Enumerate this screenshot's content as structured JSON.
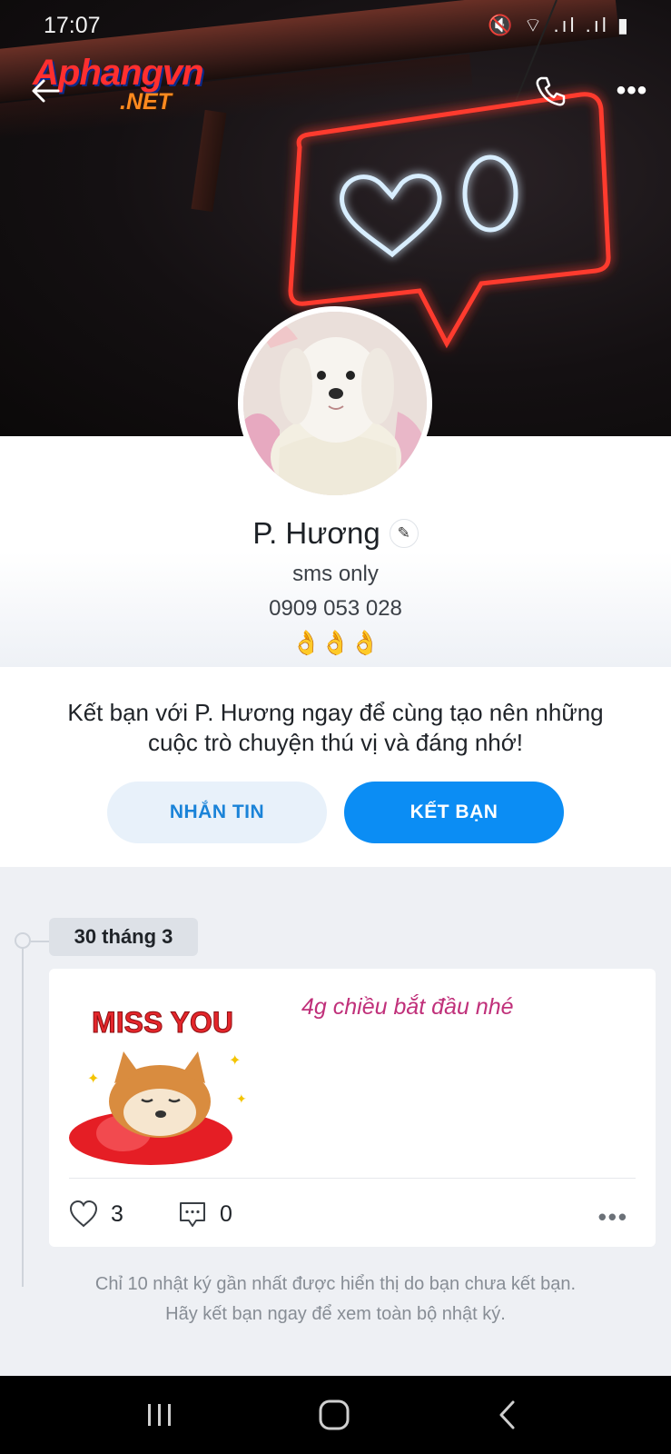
{
  "status_bar": {
    "time": "17:07",
    "icons": "🔇 ⌔ .ıl .ıl ▮"
  },
  "watermark": {
    "logo_main": "Aphangvn",
    "logo_sub": ".NET"
  },
  "header": {
    "back_icon": "back-arrow-icon",
    "call_icon": "phone-icon",
    "more_label": "•••"
  },
  "profile": {
    "name": "P. Hương",
    "edit_icon": "✎",
    "bio_line1": "sms only",
    "bio_line2": "0909 053 028",
    "bio_line3": "👌👌👌"
  },
  "friend_prompt": {
    "text": "Kết bạn với P. Hương ngay để cùng tạo nên những cuộc trò chuyện thú vị và đáng nhớ!",
    "message_button": "NHẮN TIN",
    "add_friend_button": "KẾT BẠN"
  },
  "timeline": {
    "date_label": "30 tháng 3",
    "post": {
      "sticker_text": "MISS YOU",
      "text": "4g chiều bắt đầu nhé",
      "likes": "3",
      "comments": "0",
      "more_label": "•••"
    },
    "footnote_line1": "Chỉ 10 nhật ký gần nhất được hiển thị do bạn chưa kết bạn.",
    "footnote_line2": "Hãy kết bạn ngay để xem toàn bộ nhật ký."
  },
  "colors": {
    "accent": "#0b8df4",
    "accent_light": "#e8f1fa",
    "neon_red": "#ff3b2f",
    "neon_blue": "#cfe9ff",
    "post_text": "#c0307a"
  }
}
